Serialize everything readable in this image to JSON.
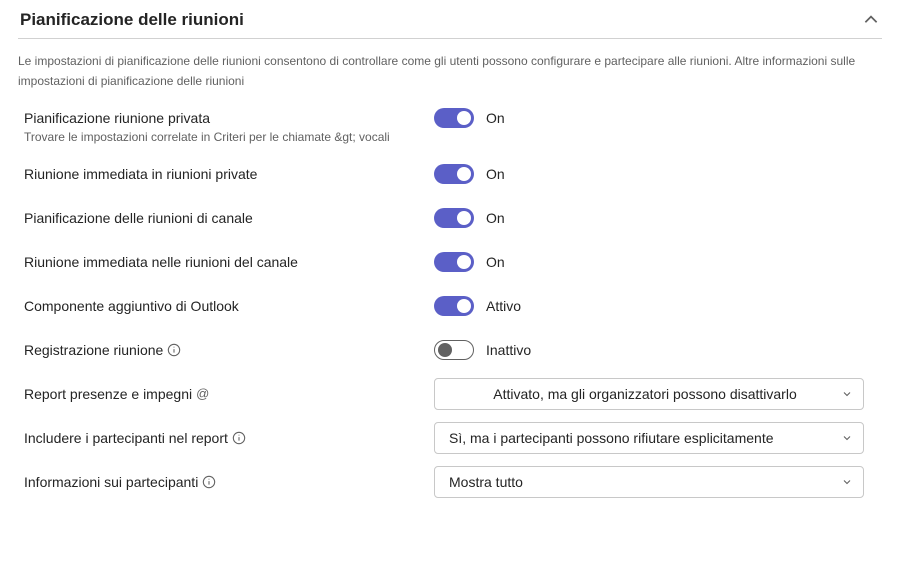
{
  "section": {
    "title": "Pianificazione delle riunioni",
    "description_prefix": "Le impostazioni di pianificazione delle riunioni consentono di controllare come gli utenti possono configurare e partecipare alle riunioni. ",
    "description_link": "Altre informazioni sulle impostazioni di pianificazione delle riunioni"
  },
  "settings": {
    "private_scheduling": {
      "label": "Pianificazione riunione privata",
      "help": "Trovare le impostazioni correlate in Criteri per le chiamate &gt; vocali",
      "state": "on",
      "state_label": "On"
    },
    "private_meet_now": {
      "label": "Riunione immediata in riunioni private",
      "state": "on",
      "state_label": "On"
    },
    "channel_scheduling": {
      "label": "Pianificazione delle riunioni di canale",
      "state": "on",
      "state_label": "On"
    },
    "channel_meet_now": {
      "label": "Riunione immediata nelle riunioni del canale",
      "state": "on",
      "state_label": "On"
    },
    "outlook_addin": {
      "label": "Componente aggiuntivo di Outlook",
      "state": "on",
      "state_label": "Attivo"
    },
    "meeting_registration": {
      "label": "Registrazione riunione",
      "state": "off",
      "state_label": "Inattivo"
    },
    "attendance_report": {
      "label": "Report presenze e impegni",
      "value": "Attivato, ma gli organizzatori possono disattivarlo"
    },
    "include_participants": {
      "label": "Includere i partecipanti nel report",
      "value": "Sì, ma i partecipanti possono rifiutare esplicitamente"
    },
    "participant_info": {
      "label": "Informazioni sui partecipanti",
      "value": "Mostra tutto"
    }
  }
}
